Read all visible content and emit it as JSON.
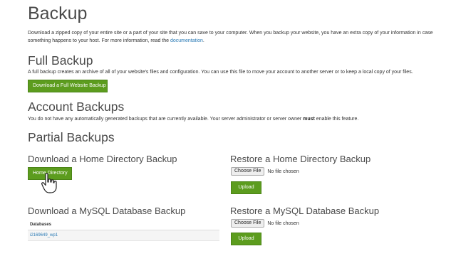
{
  "page": {
    "title": "Backup",
    "intro": {
      "text_before_link": "Download a zipped copy of your entire site or a part of your site that you can save to your computer. When you backup your website, you have an extra copy of your information in case something happens to your host. For more information, read the ",
      "link": "documentation",
      "text_after_link": "."
    }
  },
  "full_backup": {
    "heading": "Full Backup",
    "description": "A full backup creates an archive of all of your website's files and configuration. You can use this file to move your account to another server or to keep a local copy of your files.",
    "button": "Download a Full Website Backup"
  },
  "account_backups": {
    "heading": "Account Backups",
    "text_before_bold": "You do not have any automatically generated backups that are currently available. Your server administrator or server owner ",
    "bold": "must",
    "text_after_bold": " enable this feature."
  },
  "partial_backups": {
    "heading": "Partial Backups",
    "home_download": {
      "heading": "Download a Home Directory Backup",
      "button": "Home Directory"
    },
    "home_restore": {
      "heading": "Restore a Home Directory Backup",
      "choose_file": "Choose File",
      "no_file": "No file chosen",
      "upload": "Upload"
    },
    "mysql_download": {
      "heading": "Download a MySQL Database Backup",
      "table_header": "Databases",
      "rows": [
        "i2169649_wp1"
      ]
    },
    "mysql_restore": {
      "heading": "Restore a MySQL Database Backup",
      "choose_file": "Choose File",
      "no_file": "No file chosen",
      "upload": "Upload"
    }
  },
  "colors": {
    "accent_green": "#5c9c1e",
    "link_blue": "#2a7ab5"
  }
}
